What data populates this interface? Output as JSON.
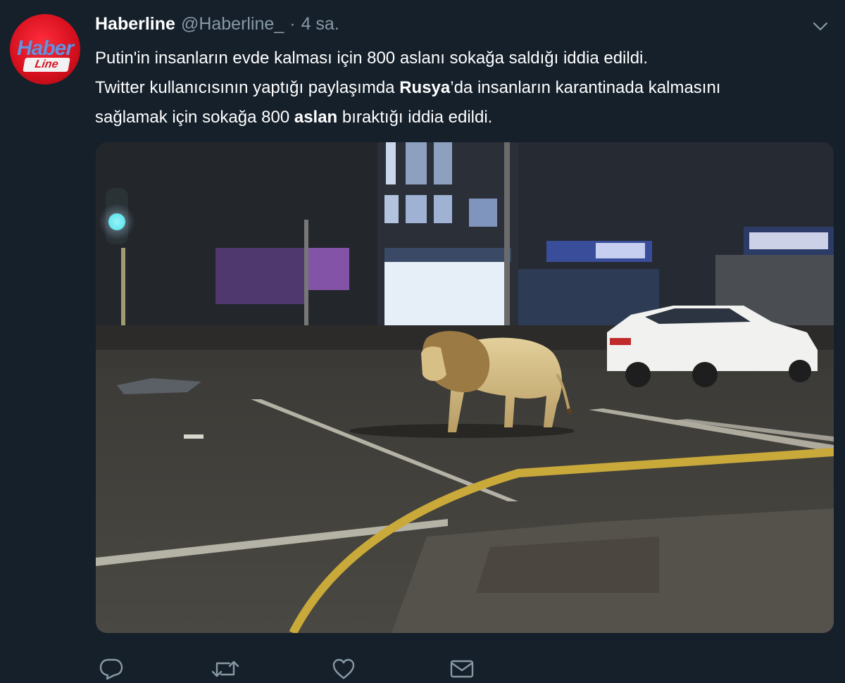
{
  "tweet": {
    "author": {
      "name": "Haberline",
      "handle": "@Haberline_",
      "separator": "·",
      "time": "4 sa.",
      "avatar_text_top": "Haber",
      "avatar_text_bottom": "Line"
    },
    "text": {
      "line1": "Putin'in insanların evde kalması için 800 aslanı sokağa saldığı iddia edildi.",
      "line2_a": "Twitter kullanıcısının yaptığı paylaşımda ",
      "line2_b": "Rusya",
      "line2_c": "’da insanların karantinada kalmasını",
      "line3_a": "sağlamak için sokağa 800 ",
      "line3_b": "aslan",
      "line3_c": " bıraktığı iddia edildi."
    },
    "media": {
      "description_icon": "lion-street-photo"
    },
    "actions": {
      "reply_icon": "reply-icon",
      "retweet_icon": "retweet-icon",
      "like_icon": "heart-icon",
      "dm_icon": "envelope-icon"
    },
    "menu_icon": "chevron-down-icon"
  },
  "colors": {
    "background": "#15202b",
    "text": "#ffffff",
    "secondary": "#8899a6",
    "brand_red": "#d8111f"
  }
}
